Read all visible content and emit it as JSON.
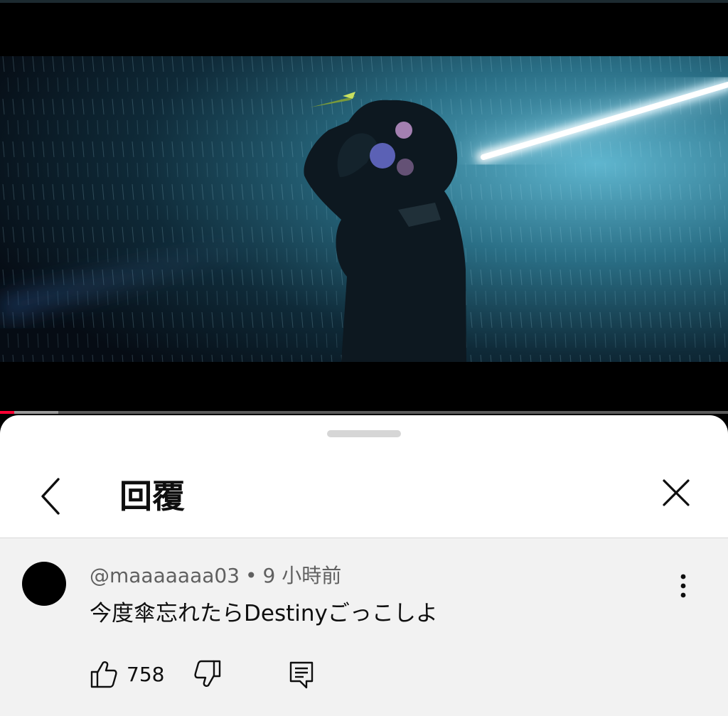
{
  "video": {
    "progress": 0.02,
    "buffered": 0.08,
    "accent_color": "#ff0033"
  },
  "sheet": {
    "title": "回覆",
    "back_icon": "chevron-left-icon",
    "close_icon": "close-icon"
  },
  "comment": {
    "author": "@maaaaaaa03",
    "separator": "•",
    "time": "9 小時前",
    "text": "今度傘忘れたらDestinyごっこしよ",
    "like_count": "758",
    "icons": {
      "like": "thumbs-up-icon",
      "dislike": "thumbs-down-icon",
      "reply": "reply-icon",
      "more": "more-vertical-icon"
    }
  }
}
